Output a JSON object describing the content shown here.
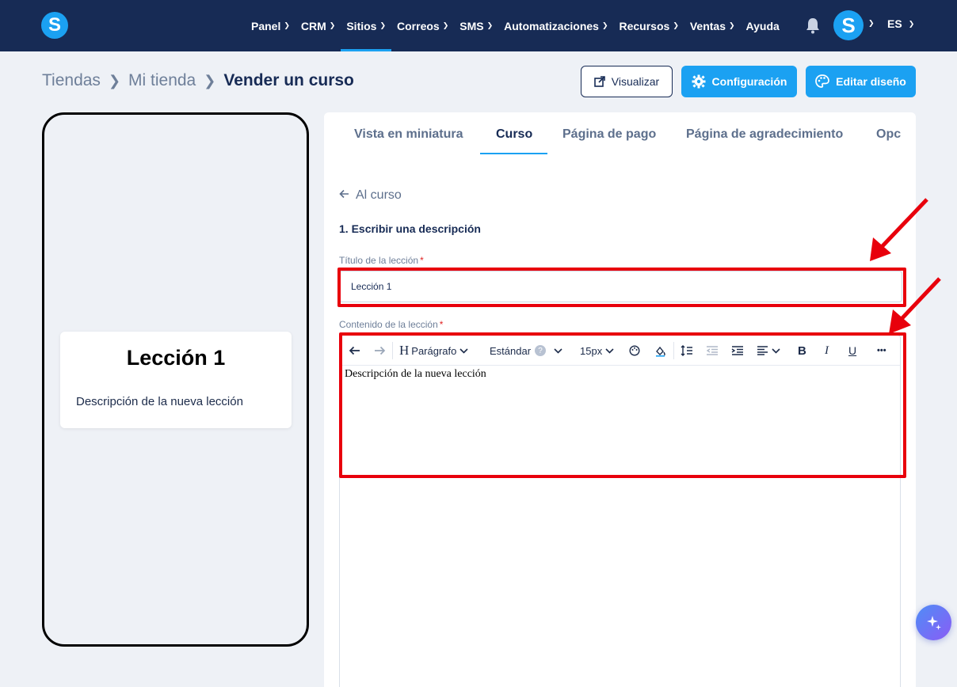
{
  "nav": {
    "logo_letter": "S",
    "items": [
      {
        "label": "Panel",
        "has_menu": true
      },
      {
        "label": "CRM",
        "has_menu": true
      },
      {
        "label": "Sitios",
        "has_menu": true,
        "active": true
      },
      {
        "label": "Correos",
        "has_menu": true
      },
      {
        "label": "SMS",
        "has_menu": true
      },
      {
        "label": "Automatizaciones",
        "has_menu": true
      },
      {
        "label": "Recursos",
        "has_menu": true
      },
      {
        "label": "Ventas",
        "has_menu": true
      },
      {
        "label": "Ayuda",
        "has_menu": false
      }
    ],
    "avatar_letter": "S",
    "language": "ES",
    "accent_color": "#1ba1f2",
    "bar_color": "#172b55"
  },
  "breadcrumb": {
    "items": [
      "Tiendas",
      "Mi tienda"
    ],
    "current": "Vender un curso"
  },
  "actions": {
    "preview_label": "Visualizar",
    "config_label": "Configuración",
    "edit_design_label": "Editar diseño"
  },
  "preview": {
    "lesson_title": "Lección 1",
    "lesson_description": "Descripción de la nueva lección"
  },
  "tabs": [
    {
      "label": "Vista en miniatura"
    },
    {
      "label": "Curso",
      "active": true
    },
    {
      "label": "Página de pago"
    },
    {
      "label": "Página de agradecimiento"
    },
    {
      "label": "Opc"
    }
  ],
  "form": {
    "back_label": "Al curso",
    "section_title": "1. Escribir una descripción",
    "title_label": "Título de la lección",
    "title_value": "Lección 1",
    "content_label": "Contenido de la lección",
    "required_mark": "*",
    "content_value": "Descripción de la nueva lección"
  },
  "toolbar": {
    "paragraph_label": "Parágrafo",
    "font_label": "Estándar",
    "help_mark": "?",
    "size_label": "15px",
    "bold_label": "B",
    "italic_label": "I",
    "underline_label": "U",
    "more_label": "•••"
  },
  "annotation_color": "#e8000c"
}
